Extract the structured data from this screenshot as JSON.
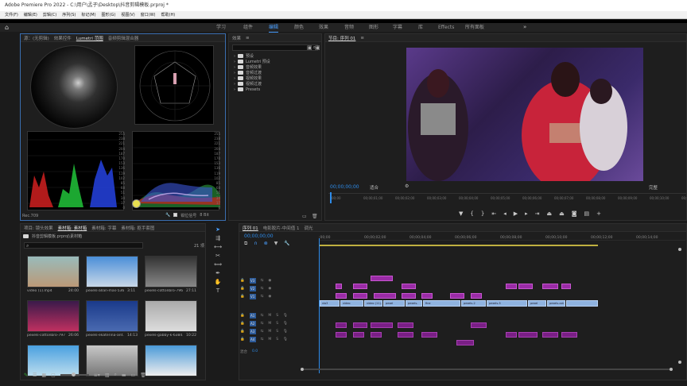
{
  "app": {
    "title": "Adobe Premiere Pro 2022 - C:\\用户\\孟子\\Desktop\\抖音剪辑模板.prproj *"
  },
  "menu": [
    "文件(F)",
    "编辑(E)",
    "剪辑(C)",
    "序列(S)",
    "标记(M)",
    "图形(G)",
    "视图(V)",
    "窗口(W)",
    "帮助(H)"
  ],
  "workspaces": [
    "学习",
    "组件",
    "编辑",
    "颜色",
    "效果",
    "音频",
    "图形",
    "字幕",
    "库",
    "Effects",
    "所有面板"
  ],
  "active_workspace": "编辑",
  "source_panel": {
    "tabs": [
      "源：(无剪辑)",
      "效果控件",
      "Lumetri 范围",
      "音频剪辑混合器"
    ],
    "active_tab": "Lumetri 范围",
    "scale_labels": [
      "255",
      "238",
      "221",
      "204",
      "187",
      "170",
      "153",
      "136",
      "119",
      "102",
      "85",
      "68",
      "51",
      "34",
      "17",
      "0"
    ],
    "footer_left": "Rec.709",
    "footer_right": "钳位信号",
    "footer_bits": "8 Bit"
  },
  "effects_panel": {
    "title": "效果",
    "items": [
      "预设",
      "Lumetri 预设",
      "音频效果",
      "音频过渡",
      "视频效果",
      "视频过渡",
      "Presets"
    ]
  },
  "program_monitor": {
    "title": "节目: 序列 01",
    "timecode_left": "00;00;00;00",
    "fit_label": "适合",
    "quality_label": "完整",
    "ruler": [
      "00;00",
      "00;00;01;00",
      "00;00;02;00",
      "00;00;03;00",
      "00;00;04;00",
      "00;00;05;00",
      "00;00;06;00",
      "00;00;07;00",
      "00;00;08;00",
      "00;00;09;00",
      "00;00;10;00",
      "00;00;11;"
    ]
  },
  "project_panel": {
    "tabs": [
      "项目: 镜头效果",
      "素材箱: 素材箱",
      "素材箱: 字幕",
      "素材箱: 抠手套图"
    ],
    "active_tab": "素材箱: 素材箱",
    "path": "抖音剪辑模板.prproj\\素材箱",
    "count": "21 项",
    "thumbs": [
      {
        "name": "video (1).mp4",
        "dur": "24:00"
      },
      {
        "name": "pexels-allan-mas-536...",
        "dur": "3:11"
      },
      {
        "name": "pexels-cottonbro-796...",
        "dur": "27:11"
      },
      {
        "name": "pexels-cottonbro-797...",
        "dur": "26:06"
      },
      {
        "name": "pexels-ekaterina-ant...",
        "dur": "14:13"
      },
      {
        "name": "pexels-gabby-k-6384...",
        "dur": "10:22"
      },
      {
        "name": "",
        "dur": ""
      },
      {
        "name": "",
        "dur": ""
      },
      {
        "name": "",
        "dur": ""
      }
    ]
  },
  "timeline": {
    "tabs": [
      "序列 01",
      "电影胶片-中间值 1",
      "调光"
    ],
    "timecode": "00;00;00;00",
    "ruler": [
      ":00;00",
      "00;00;02;00",
      "00;00;04;00",
      "00;00;06;00",
      "00;00;08;00",
      "00;00;10;00",
      "00;00;12;00",
      "00;00;14;00"
    ],
    "tracks_video": [
      "V3",
      "V2",
      "V1"
    ],
    "tracks_audio": [
      "A1",
      "A2",
      "A3",
      "A4"
    ],
    "mix_label": "混合",
    "mix_value": "0.0",
    "v1_clips": [
      "vlo3",
      "video",
      "video (11).",
      "pexel",
      "pexels-cottonbro",
      "fine",
      "pexels-2",
      "pexels-5",
      "pexel",
      "pexels-cot"
    ]
  },
  "colors": {
    "accent": "#2d8ceb",
    "clip_purple": "#9a2ba6",
    "clip_blue": "#8fb3e0"
  }
}
